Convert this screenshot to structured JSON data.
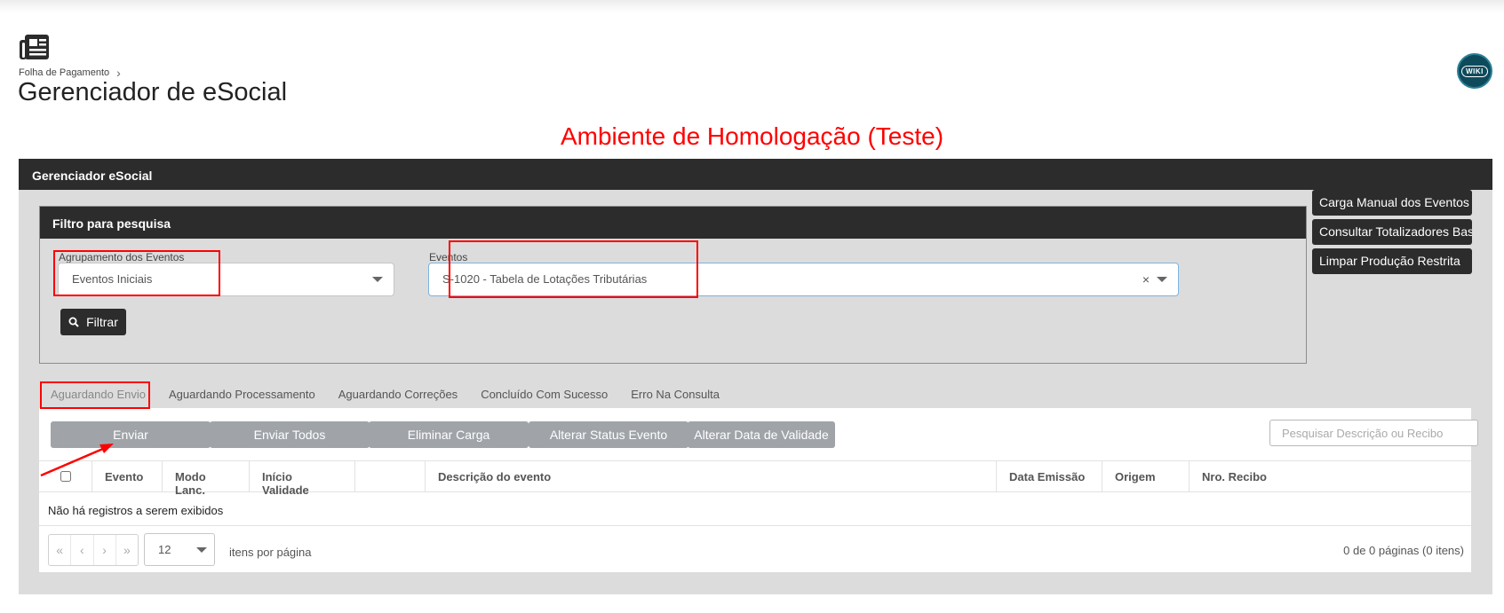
{
  "breadcrumb": {
    "parent": "Folha de Pagamento"
  },
  "page": {
    "title": "Gerenciador de eSocial",
    "environment_banner": "Ambiente de Homologação (Teste)"
  },
  "wiki": {
    "label": "WIKI"
  },
  "panel": {
    "title": "Gerenciador eSocial"
  },
  "filter": {
    "title": "Filtro para pesquisa",
    "group_label": "Agrupamento dos Eventos",
    "group_value": "Eventos Iniciais",
    "events_label": "Eventos",
    "events_value": "S-1020 - Tabela de Lotações Tributárias",
    "clear_symbol": "×",
    "filter_button": "Filtrar"
  },
  "side_actions": {
    "manual_load": "Carga Manual dos Eventos",
    "totalizers": "Consultar Totalizadores Base",
    "clear_restricted": "Limpar Produção Restrita"
  },
  "tabs": [
    {
      "label": "Aguardando Envio",
      "active": true
    },
    {
      "label": "Aguardando Processamento"
    },
    {
      "label": "Aguardando Correções"
    },
    {
      "label": "Concluído Com Sucesso"
    },
    {
      "label": "Erro Na Consulta"
    }
  ],
  "actions": {
    "send": "Enviar",
    "send_all": "Enviar Todos",
    "delete_load": "Eliminar Carga",
    "change_status": "Alterar Status Evento",
    "change_validity": "Alterar Data de Validade",
    "search_placeholder": "Pesquisar Descrição ou Recibo"
  },
  "grid": {
    "columns": [
      "Evento",
      "Modo Lanc.",
      "Início Validade",
      "",
      "Descrição do evento",
      "Data Emissão",
      "Origem",
      "Nro. Recibo"
    ],
    "empty_message": "Não há registros a serem exibidos"
  },
  "pagination": {
    "first": "«",
    "prev": "‹",
    "next": "›",
    "last": "»",
    "page_size": "12",
    "items_label": "itens por página",
    "pages_info": "0 de 0 páginas (0 itens)"
  },
  "colors": {
    "annotation_red": "#ff0000",
    "header_dark": "#2c2c2c",
    "button_gray": "#a0a4a9",
    "panel_bg": "#dcdcdc"
  },
  "icons": {
    "page": "newspaper-icon",
    "search": "search-icon",
    "caret": "caret-down-icon"
  }
}
